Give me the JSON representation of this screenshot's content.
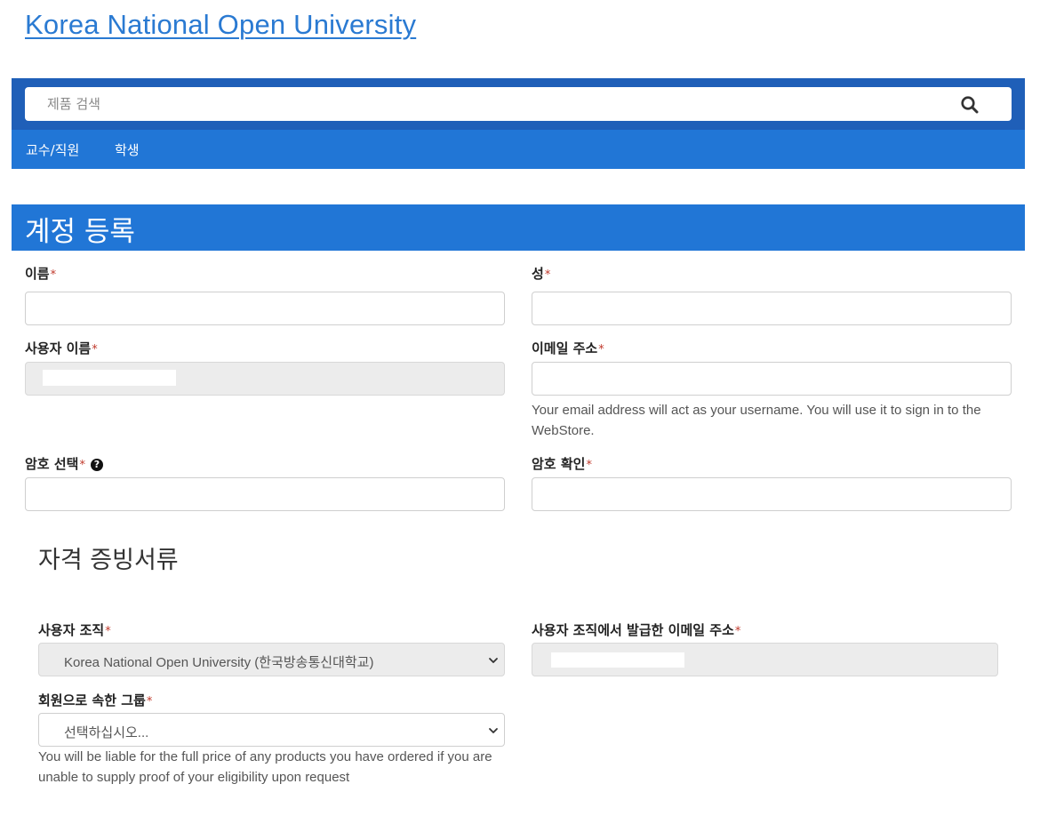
{
  "site": {
    "title": "Korea National Open University"
  },
  "search": {
    "placeholder": "제품 검색"
  },
  "nav": {
    "items": [
      {
        "label": "교수/직원"
      },
      {
        "label": "학생"
      }
    ]
  },
  "page": {
    "title": "계정 등록"
  },
  "form": {
    "required_mark": "*",
    "first_name": {
      "label": "이름",
      "value": ""
    },
    "last_name": {
      "label": "성",
      "value": ""
    },
    "username": {
      "label": "사용자 이름",
      "value": ""
    },
    "email": {
      "label": "이메일 주소",
      "value": "",
      "help": "Your email address will act as your username. You will use it to sign in to the WebStore."
    },
    "password": {
      "label": "암호 선택",
      "value": ""
    },
    "password_confirm": {
      "label": "암호 확인",
      "value": ""
    }
  },
  "credentials": {
    "title": "자격 증빙서류",
    "organization": {
      "label": "사용자 조직",
      "selected": "Korea National Open University (한국방송통신대학교)"
    },
    "org_email": {
      "label": "사용자 조직에서 발급한 이메일 주소",
      "value": ""
    },
    "group": {
      "label": "회원으로 속한 그룹",
      "selected": "선택하십시오..."
    },
    "liability_note": "You will be liable for the full price of any products you have ordered if you are unable to supply proof of your eligibility upon request"
  },
  "colors": {
    "primary": "#2176d6",
    "primary_dark": "#1f5fb8",
    "link": "#2a7ad2",
    "required": "#c0392b"
  }
}
